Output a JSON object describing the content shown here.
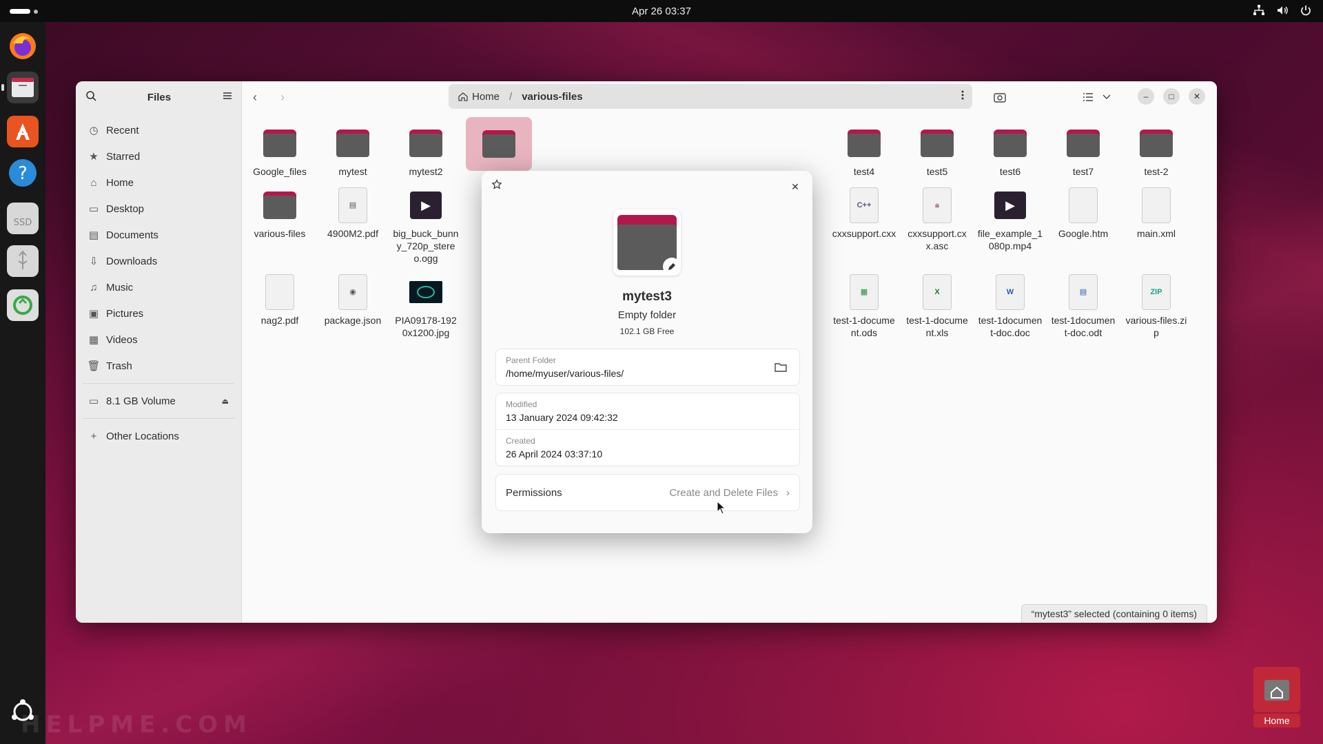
{
  "topbar": {
    "datetime": "Apr 26  03:37"
  },
  "window": {
    "sidebar": {
      "title": "Files",
      "items": [
        {
          "label": "Recent"
        },
        {
          "label": "Starred"
        },
        {
          "label": "Home"
        },
        {
          "label": "Desktop"
        },
        {
          "label": "Documents"
        },
        {
          "label": "Downloads"
        },
        {
          "label": "Music"
        },
        {
          "label": "Pictures"
        },
        {
          "label": "Videos"
        },
        {
          "label": "Trash"
        }
      ],
      "volume": "8.1 GB Volume",
      "other": "Other Locations"
    },
    "pathbar": {
      "home": "Home",
      "current": "various-files"
    },
    "files_row1": [
      "Google_files",
      "mytest",
      "mytest2",
      "mytest3",
      "",
      "",
      "",
      "",
      "test4",
      "test5",
      "test6",
      "test7",
      "test-2"
    ],
    "files_row2": [
      "various-files",
      "4900M2.pdf",
      "big_buck_bunny_720p_stereo.ogg",
      "",
      "",
      "",
      "",
      "",
      "cxxsupport.cxx",
      "cxxsupport.cxx.asc",
      "file_example_1080p.mp4",
      "Google.htm",
      "main.xml"
    ],
    "files_row3": [
      "nag2.pdf",
      "package.json",
      "PIA09178-1920x1200.jpg",
      "",
      "",
      "",
      "",
      "",
      "test-1-document.ods",
      "test-1-document.xls",
      "test-1document-doc.doc",
      "test-1document-doc.odt",
      "various-files.zip"
    ],
    "status": "“mytest3” selected  (containing 0 items)"
  },
  "dialog": {
    "name": "mytest3",
    "kind": "Empty folder",
    "free": "102.1 GB Free",
    "parent_label": "Parent Folder",
    "parent_value": "/home/myuser/various-files/",
    "modified_label": "Modified",
    "modified_value": "13 January 2024 09:42:32",
    "created_label": "Created",
    "created_value": "26 April 2024 03:37:10",
    "permissions_label": "Permissions",
    "permissions_value": "Create and Delete Files"
  },
  "desktop": {
    "home_label": "Home",
    "watermark": "HELPME.COM"
  },
  "colors": {
    "accent": "#b3184a",
    "folder": "#5b5b5b",
    "selection": "#e8b4bf"
  }
}
